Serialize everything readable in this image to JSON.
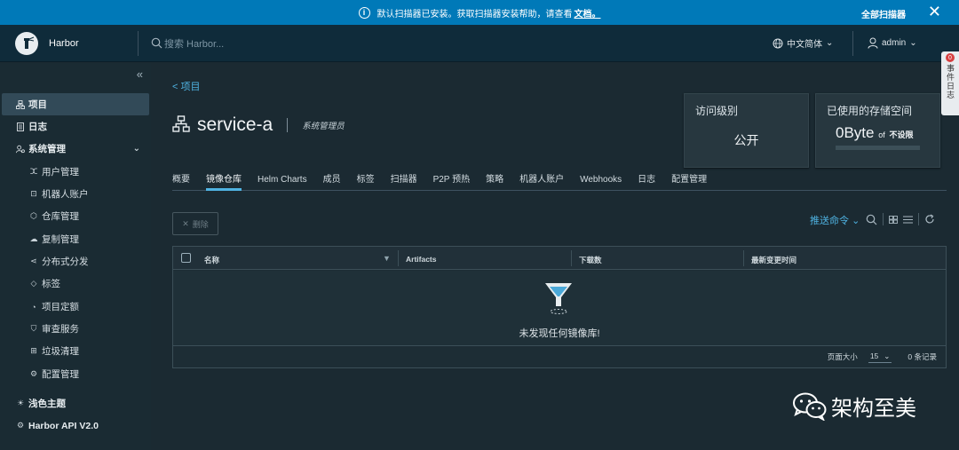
{
  "banner": {
    "message": "默认扫描器已安装。获取扫描器安装帮助，请查看",
    "link": "文档。",
    "all_label": "全部扫描器",
    "close_symbol": "✕"
  },
  "header": {
    "brand": "Harbor",
    "search_placeholder": "搜索 Harbor...",
    "language": "中文简体",
    "user": "admin"
  },
  "sidebar": {
    "collapse_symbol": "«",
    "items": [
      {
        "label": "项目"
      },
      {
        "label": "日志"
      },
      {
        "label": "系统管理"
      },
      {
        "label": "用户管理"
      },
      {
        "label": "机器人账户"
      },
      {
        "label": "仓库管理"
      },
      {
        "label": "复制管理"
      },
      {
        "label": "分布式分发"
      },
      {
        "label": "标签"
      },
      {
        "label": "项目定额"
      },
      {
        "label": "审查服务"
      },
      {
        "label": "垃圾清理"
      },
      {
        "label": "配置管理"
      },
      {
        "label": "浅色主题"
      },
      {
        "label": "Harbor API V2.0"
      }
    ]
  },
  "main": {
    "back_label": "<  项目",
    "project_name": "service-a",
    "role": "系统管理员",
    "access_card": {
      "title": "访问级别",
      "value": "公开"
    },
    "storage_card": {
      "title": "已使用的存储空间",
      "used": "0Byte",
      "of": "of",
      "limit": "不设限",
      "used_fraction": 0
    },
    "tabs": [
      {
        "label": "概要"
      },
      {
        "label": "镜像仓库"
      },
      {
        "label": "Helm Charts"
      },
      {
        "label": "成员"
      },
      {
        "label": "标签"
      },
      {
        "label": "扫描器"
      },
      {
        "label": "P2P 预热"
      },
      {
        "label": "策略"
      },
      {
        "label": "机器人账户"
      },
      {
        "label": "Webhooks"
      },
      {
        "label": "日志"
      },
      {
        "label": "配置管理"
      }
    ],
    "active_tab": "镜像仓库",
    "delete_label": "删除",
    "push_label": "推送命令",
    "table": {
      "columns": [
        "名称",
        "Artifacts",
        "下载数",
        "最新变更时间"
      ],
      "empty_text": "未发现任何镜像库!",
      "page_size_label": "页面大小",
      "page_size": "15",
      "count_text": "0 条记录"
    }
  },
  "drawer": {
    "label": "事件日志",
    "badge": "0"
  },
  "watermark": {
    "text": "架构至美"
  },
  "colors": {
    "accent": "#4fb3e2",
    "banner": "#0079b8",
    "header": "#0f2b3a",
    "background": "#1b2a32"
  }
}
